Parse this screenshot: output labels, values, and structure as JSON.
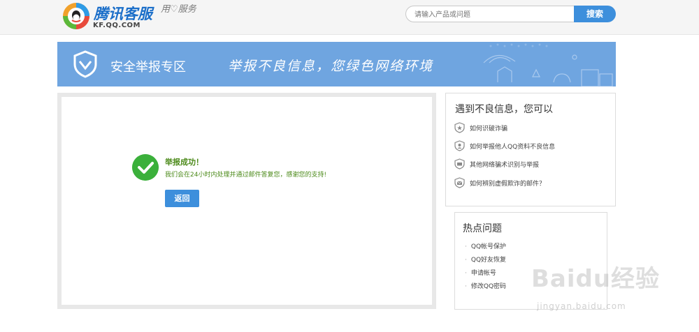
{
  "header": {
    "logo_title": "腾讯客服",
    "logo_sub": "KF.QQ.COM",
    "logo_slogan": "用♡服务",
    "search_placeholder": "请输入产品或问题",
    "search_button": "搜索"
  },
  "banner": {
    "title": "安全举报专区",
    "slogan": "举报不良信息，您绿色网络环境"
  },
  "result": {
    "title": "举报成功！",
    "message": "我们会在24小时内处理并通过邮件答复您，感谢您的支持!",
    "back_button": "返回"
  },
  "sidebar": {
    "guide_title": "遇到不良信息，您可以",
    "guide_items": [
      {
        "label": "如何识破诈骗"
      },
      {
        "label": "如何举报他人QQ资料不良信息"
      },
      {
        "label": "其他网络骗术识别与举报"
      },
      {
        "label": "如何辨别虚假欺诈的邮件？"
      }
    ],
    "hot_title": "热点问题",
    "hot_items": [
      {
        "label": "QQ帐号保护"
      },
      {
        "label": "QQ好友恢复"
      },
      {
        "label": "申请帐号"
      },
      {
        "label": "修改QQ密码"
      }
    ]
  },
  "watermark": {
    "text": "Baidu经验",
    "sub": "jingyan.baidu.com"
  },
  "colors": {
    "brand_blue": "#3d8fdc",
    "banner_blue": "#6fa5e0",
    "success_green": "#3bb03b",
    "success_text": "#4c8a1a"
  }
}
